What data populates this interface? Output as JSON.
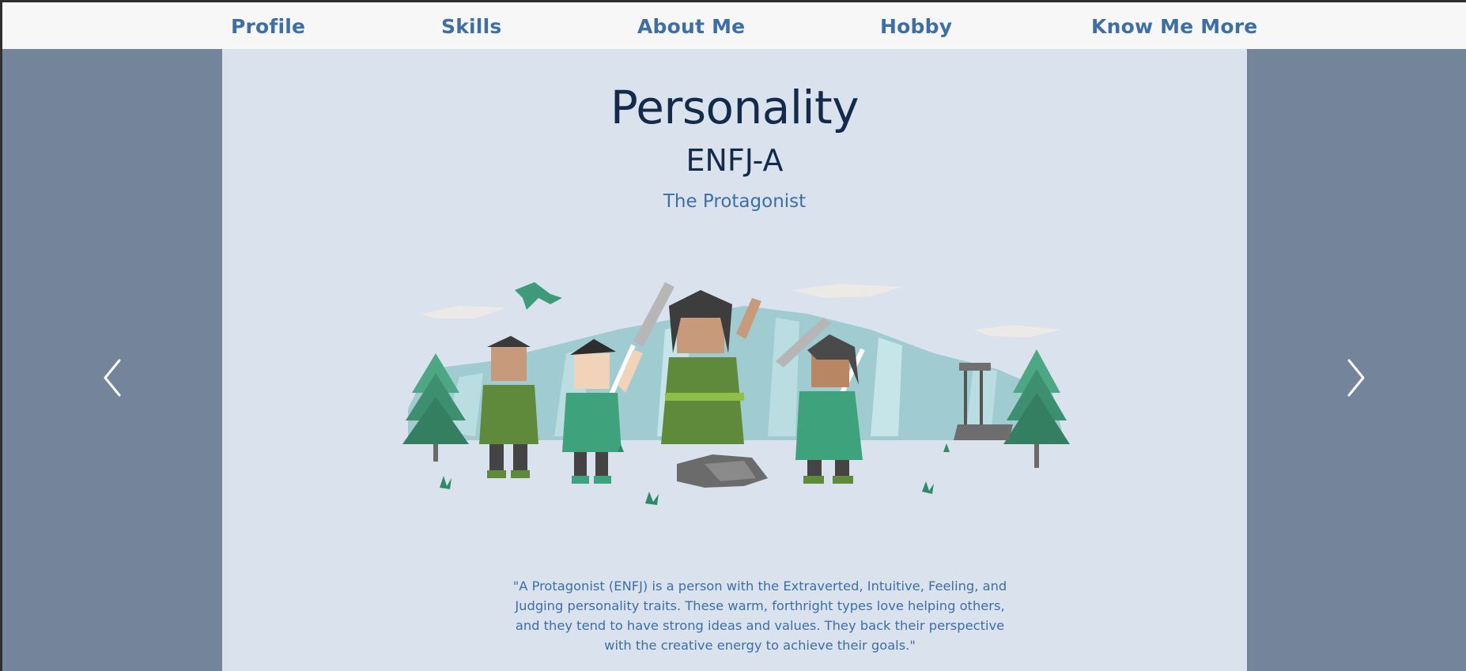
{
  "nav": {
    "items": [
      {
        "label": "Profile"
      },
      {
        "label": "Skills"
      },
      {
        "label": "About Me"
      },
      {
        "label": "Hobby"
      },
      {
        "label": "Know Me More"
      }
    ]
  },
  "hero": {
    "title": "Personality",
    "type_code": "ENFJ-A",
    "type_name": "The Protagonist",
    "quote": "\"A Protagonist (ENFJ) is a person with the Extraverted, Intuitive, Feeling, and Judging personality traits. These warm, forthright types love helping others, and they tend to have strong ideas and values. They back their perspective with the creative energy to achieve their goals.\""
  },
  "carousel": {
    "prev_icon": "chevron-left-icon",
    "next_icon": "chevron-right-icon"
  },
  "colors": {
    "nav_bg": "#f8f7f7",
    "nav_link": "#3d6fa5",
    "side_bg": "#74859b",
    "content_bg": "#dae2ee",
    "title": "#142a4a",
    "accent": "#3d6fa5"
  }
}
